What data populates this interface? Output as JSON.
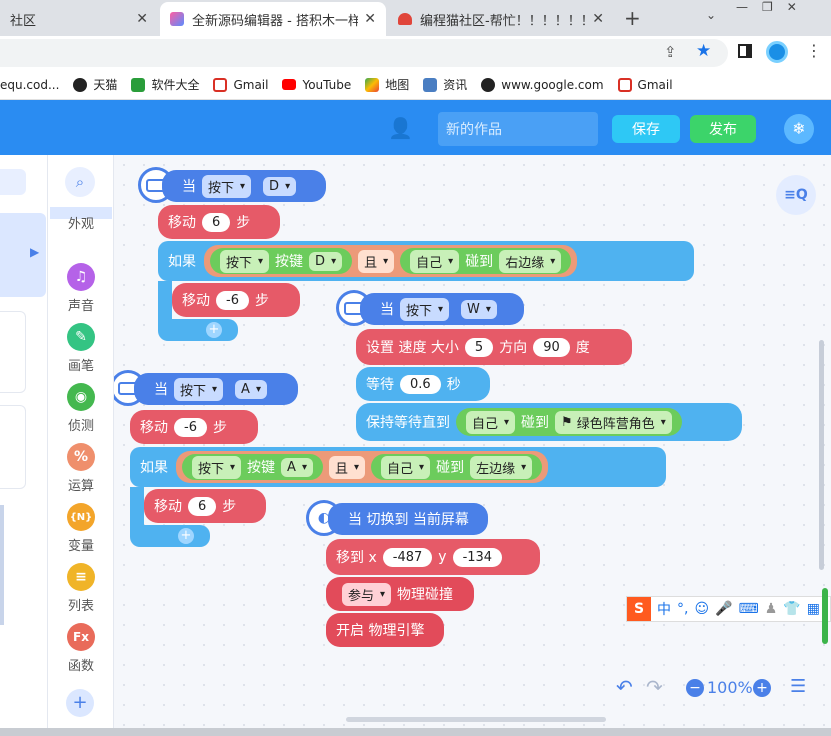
{
  "browser": {
    "tabs": [
      {
        "label": "社区",
        "active": false
      },
      {
        "label": "全新源码编辑器 - 搭积木一样有",
        "active": true
      },
      {
        "label": "编程猫社区-帮忙！！！！！！",
        "active": false
      }
    ],
    "new_tab": "+",
    "bookmarks": [
      {
        "label": "equ.cod...",
        "color": "#555"
      },
      {
        "label": "天猫",
        "color": "#222"
      },
      {
        "label": "软件大全",
        "color": "#2a9d3a"
      },
      {
        "label": "Gmail",
        "color": "#d93025"
      },
      {
        "label": "YouTube",
        "color": "#ff0000"
      },
      {
        "label": "地图",
        "color": "#34a853"
      },
      {
        "label": "资讯",
        "color": "#4a7ec2"
      },
      {
        "label": "www.google.com",
        "color": "#222"
      },
      {
        "label": "Gmail",
        "color": "#d93025"
      }
    ]
  },
  "app": {
    "work_name_placeholder": "新的作品",
    "save": "保存",
    "publish": "发布"
  },
  "categories": [
    {
      "label": "外观",
      "color": "#e066a8",
      "glyph": "☻"
    },
    {
      "label": "声音",
      "color": "#b562e8",
      "glyph": "♫"
    },
    {
      "label": "画笔",
      "color": "#34c483",
      "glyph": "✎"
    },
    {
      "label": "侦测",
      "color": "#44b84f",
      "glyph": "◉"
    },
    {
      "label": "运算",
      "color": "#ef8f6c",
      "glyph": "%"
    },
    {
      "label": "变量",
      "color": "#f3a52a",
      "glyph": "{N}"
    },
    {
      "label": "列表",
      "color": "#f0b428",
      "glyph": "≡"
    },
    {
      "label": "函数",
      "color": "#e96b5a",
      "glyph": "Fx"
    }
  ],
  "blocks": {
    "when": "当",
    "press": "按下",
    "key_d": "D",
    "key_w": "W",
    "key_a": "A",
    "move": "移动",
    "steps": "步",
    "if": "如果",
    "key_label": "按键",
    "and": "且",
    "self": "自己",
    "touch": "碰到",
    "right_edge": "右边缘",
    "left_edge": "左边缘",
    "val_6": "6",
    "val_neg6": "-6",
    "set_speed": "设置 速度 大小",
    "speed": "5",
    "direction": "方向",
    "dir_val": "90",
    "degree": "度",
    "wait": "等待",
    "wait_val": "0.6",
    "seconds": "秒",
    "wait_until": "保持等待直到",
    "green_flag_role": "绿色阵营角色",
    "switch_to": "当 切换到 当前屏幕",
    "move_to_x": "移到 x",
    "x_val": "-487",
    "y_label": "y",
    "y_val": "-134",
    "join": "参与",
    "physics_collision": "物理碰撞",
    "start_physics": "开启 物理引擎"
  },
  "zoom": "100%",
  "ime": {
    "label": "中"
  }
}
